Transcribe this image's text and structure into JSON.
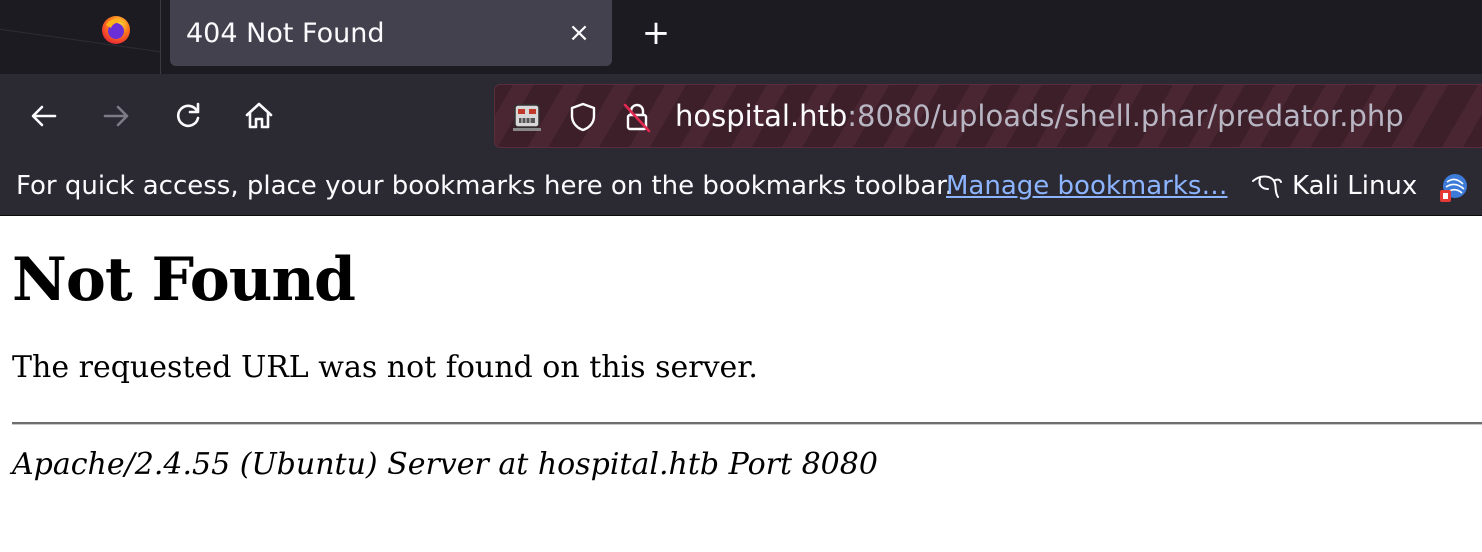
{
  "browser": {
    "tab": {
      "title": "404 Not Found",
      "close_glyph": "×"
    },
    "new_tab_glyph": "+",
    "url": {
      "host": "hospital.htb",
      "rest": ":8080/uploads/shell.phar/predator.php"
    },
    "bookmarks_toolbar": {
      "hint": "For quick access, place your bookmarks here on the bookmarks toolbar.",
      "manage_link": "Manage bookmarks…",
      "items": [
        {
          "label": "Kali Linux",
          "icon": "kali-dragon-icon"
        }
      ]
    },
    "colors": {
      "tabstrip_bg": "#1c1b22",
      "toolbar_bg": "#2b2a33",
      "active_tab_bg": "#42414d",
      "urlbar_stripe_dark": "#3d1f29",
      "urlbar_stripe_light": "#4a2532",
      "link": "#8cb4ff"
    }
  },
  "page": {
    "heading": "Not Found",
    "message": "The requested URL was not found on this server.",
    "server_signature": "Apache/2.4.55 (Ubuntu) Server at hospital.htb Port 8080"
  }
}
